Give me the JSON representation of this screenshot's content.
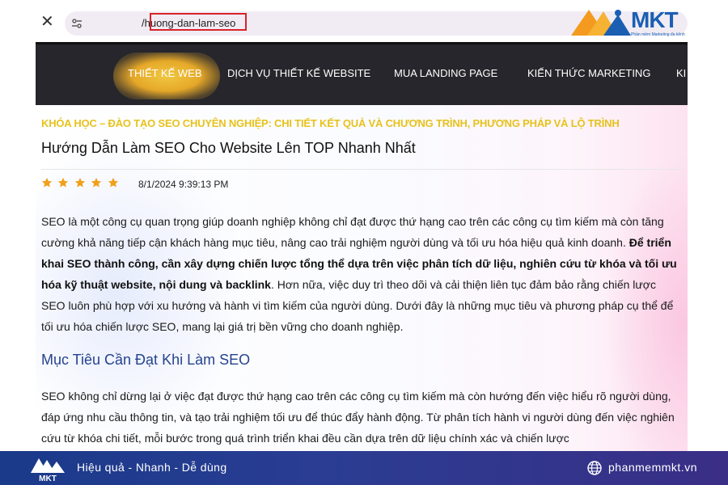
{
  "browser": {
    "url": "/huong-dan-lam-seo"
  },
  "logo": {
    "name": "MKT",
    "tagline": "Phần mềm Marketing đa kênh"
  },
  "nav": {
    "items": [
      {
        "label": "THIẾT KẾ WEB",
        "active": true
      },
      {
        "label": "DỊCH VỤ THIẾT KẾ WEBSITE"
      },
      {
        "label": "MUA LANDING PAGE"
      },
      {
        "label": "KIẾN THỨC MARKETING"
      },
      {
        "label": "KI"
      }
    ]
  },
  "article": {
    "breadcrumb": "KHÓA HỌC – ĐÀO TẠO SEO CHUYÊN NGHIỆP: CHI TIẾT KẾT QUẢ VÀ CHƯƠNG TRÌNH, PHƯƠNG PHÁP VÀ LỘ TRÌNH",
    "title": "Hướng Dẫn Làm SEO Cho Website Lên TOP Nhanh Nhất",
    "rating": 5,
    "date": "8/1/2024 9:39:13 PM",
    "intro_start": "SEO là một công cụ quan trọng giúp doanh nghiệp không chỉ đạt được thứ hạng cao trên các công cụ tìm kiếm mà còn tăng cường khả năng tiếp cận khách hàng mục tiêu, nâng cao trải nghiệm người dùng và tối ưu hóa hiệu quả kinh doanh. ",
    "intro_bold": "Để triển khai SEO thành công, cần xây dựng chiến lược tổng thể dựa trên việc phân tích dữ liệu, nghiên cứu từ khóa và tối ưu hóa kỹ thuật website, nội dung và backlink",
    "intro_end": ". Hơn nữa, việc duy trì theo dõi và cải thiện liên tục đảm bảo rằng chiến lược SEO luôn phù hợp với xu hướng và hành vi tìm kiếm của người dùng. Dưới đây là những mục tiêu và phương pháp cụ thể để tối ưu hóa chiến lược SEO, mang lại giá trị bền vững cho doanh nghiệp.",
    "section_heading": "Mục Tiêu Cần Đạt Khi Làm SEO",
    "section_text": "SEO không chỉ dừng lại ở việc đạt được thứ hạng cao trên các công cụ tìm kiếm mà còn hướng đến việc hiểu rõ người dùng, đáp ứng nhu cầu thông tin, và tạo trải nghiệm tối ưu để thúc đẩy hành động. Từ phân tích hành vi người dùng đến việc nghiên cứu từ khóa chi tiết, mỗi bước trong quá trình triển khai đều cần dựa trên dữ liệu chính xác và chiến lược"
  },
  "banner": {
    "tagline": "Hiệu quả - Nhanh - Dễ dùng",
    "website": "phanmemmkt.vn",
    "logo_text": "MKT"
  },
  "colors": {
    "nav_bg": "#26262c",
    "nav_active": "#e6a829",
    "breadcrumb": "#e7c21c",
    "heading": "#25438f",
    "star": "#f0a11b",
    "banner": "#22388c",
    "url_highlight": "#d8232a"
  }
}
